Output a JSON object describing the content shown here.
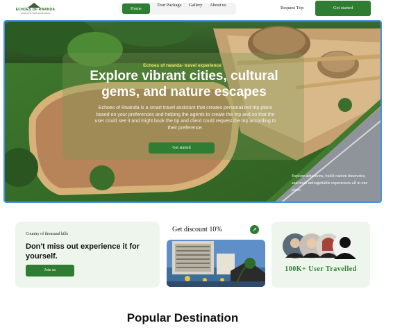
{
  "nav": {
    "logo_name": "ECHOES OF RWANDA",
    "logo_tag": "LAND OF A THOUSAND HILLS",
    "links": [
      "Home",
      "Tour Package",
      "Gallery",
      "About us"
    ],
    "request_trip": "Request Trip",
    "get_started": "Get started"
  },
  "hero": {
    "eyebrow": "Echoes of rwanda- travel experience",
    "headline": "Explore vibrant cities, cultural gems, and nature escapes",
    "description": "Echoes of Rwanda is a smart travel assistant that creates personalized trip plans based on your preferences and helping the agents to create the trip and so that the user could see it and might book the tip and client could request the trip according to their preference.",
    "cta": "Get started",
    "side_note": "Explore attractions, build custom itineraries, and book unforgettable experiences all in one place."
  },
  "cards": {
    "card1": {
      "label": "Country of thousand hills",
      "headline": "Don't miss out experience it for yourself.",
      "button": "Join us"
    },
    "card2": {
      "title": "Get discount 10%",
      "arrow_icon": "arrow-up-right-icon"
    },
    "card3": {
      "text": "100K+ User Travelled"
    }
  },
  "popular": {
    "title": "Popular Destination"
  },
  "colors": {
    "accent": "#2e7d32",
    "card_bg": "#eef5ec",
    "selection": "#4a90e2"
  }
}
